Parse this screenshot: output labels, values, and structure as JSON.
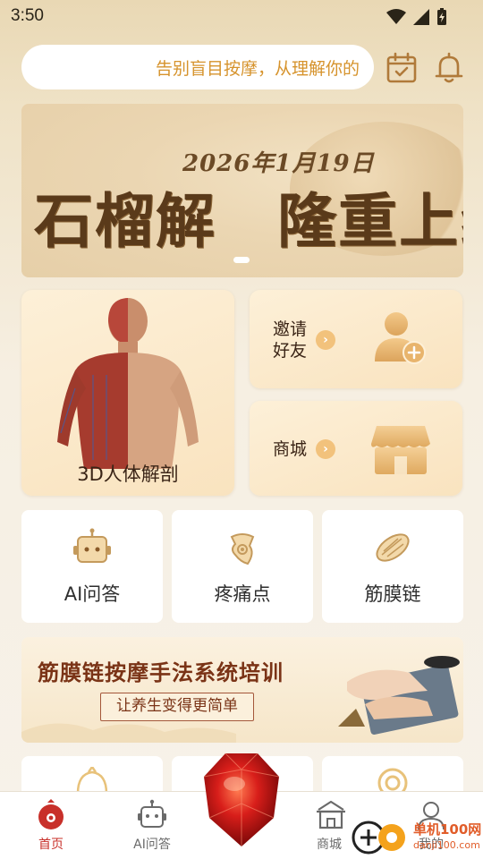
{
  "status_bar": {
    "time": "3:50"
  },
  "search": {
    "placeholder": "告别盲目按摩，从理解你的"
  },
  "banner": {
    "date": "2026年1月19日",
    "title": "石榴解　隆重上线"
  },
  "feature_cards": {
    "anatomy": "3D人体解剖",
    "invite": "邀请好友",
    "invite_line1": "邀请",
    "invite_line2": "好友",
    "mall": "商城"
  },
  "tools": [
    {
      "label": "AI问答",
      "icon": "robot-icon"
    },
    {
      "label": "疼痛点",
      "icon": "pain-point-icon"
    },
    {
      "label": "筋膜链",
      "icon": "fascia-icon"
    }
  ],
  "training": {
    "title": "筋膜链按摩手法系统培训",
    "subtitle": "让养生变得更简单"
  },
  "bottom_nav": {
    "items": [
      {
        "label": "首页",
        "icon": "home-pomegranate-icon",
        "active": true
      },
      {
        "label": "AI问答",
        "icon": "robot-icon"
      },
      {
        "label": "商城",
        "icon": "shop-icon"
      },
      {
        "label": "我的",
        "icon": "profile-icon"
      }
    ]
  },
  "watermark": {
    "line1": "单机100网",
    "line2": "danji100.com"
  },
  "colors": {
    "accent": "#d6932c",
    "active_nav": "#c8302a",
    "card_bg": "#f9e3bf"
  }
}
